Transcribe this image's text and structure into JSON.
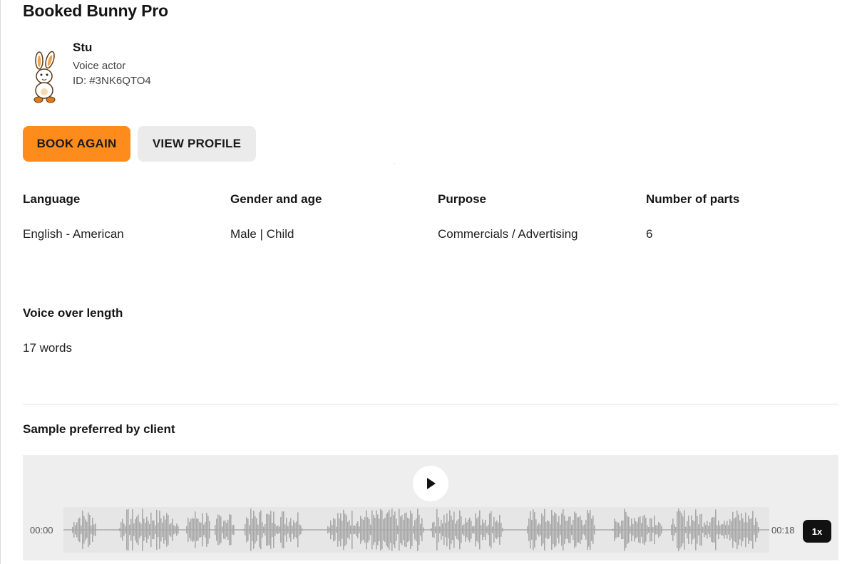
{
  "page": {
    "title": "Booked Bunny Pro"
  },
  "actor": {
    "name": "Stu",
    "role": "Voice actor",
    "id": "ID: #3NK6QTO4"
  },
  "actions": {
    "book_again": "BOOK AGAIN",
    "view_profile": "VIEW PROFILE"
  },
  "details": [
    {
      "label": "Language",
      "value": "English - American"
    },
    {
      "label": "Gender and age",
      "value": "Male | Child"
    },
    {
      "label": "Purpose",
      "value": "Commercials / Advertising"
    },
    {
      "label": "Number of parts",
      "value": "6"
    }
  ],
  "length": {
    "label": "Voice over length",
    "value": "17 words"
  },
  "sample": {
    "label": "Sample preferred by client",
    "current_time": "00:00",
    "duration": "00:18",
    "speed": "1x",
    "play_icon": "play-icon"
  },
  "colors": {
    "accent": "#fd8c1d",
    "secondary_button": "#ebebeb",
    "player_bg": "#eeeeee",
    "waveform": "#a9a9a9"
  }
}
